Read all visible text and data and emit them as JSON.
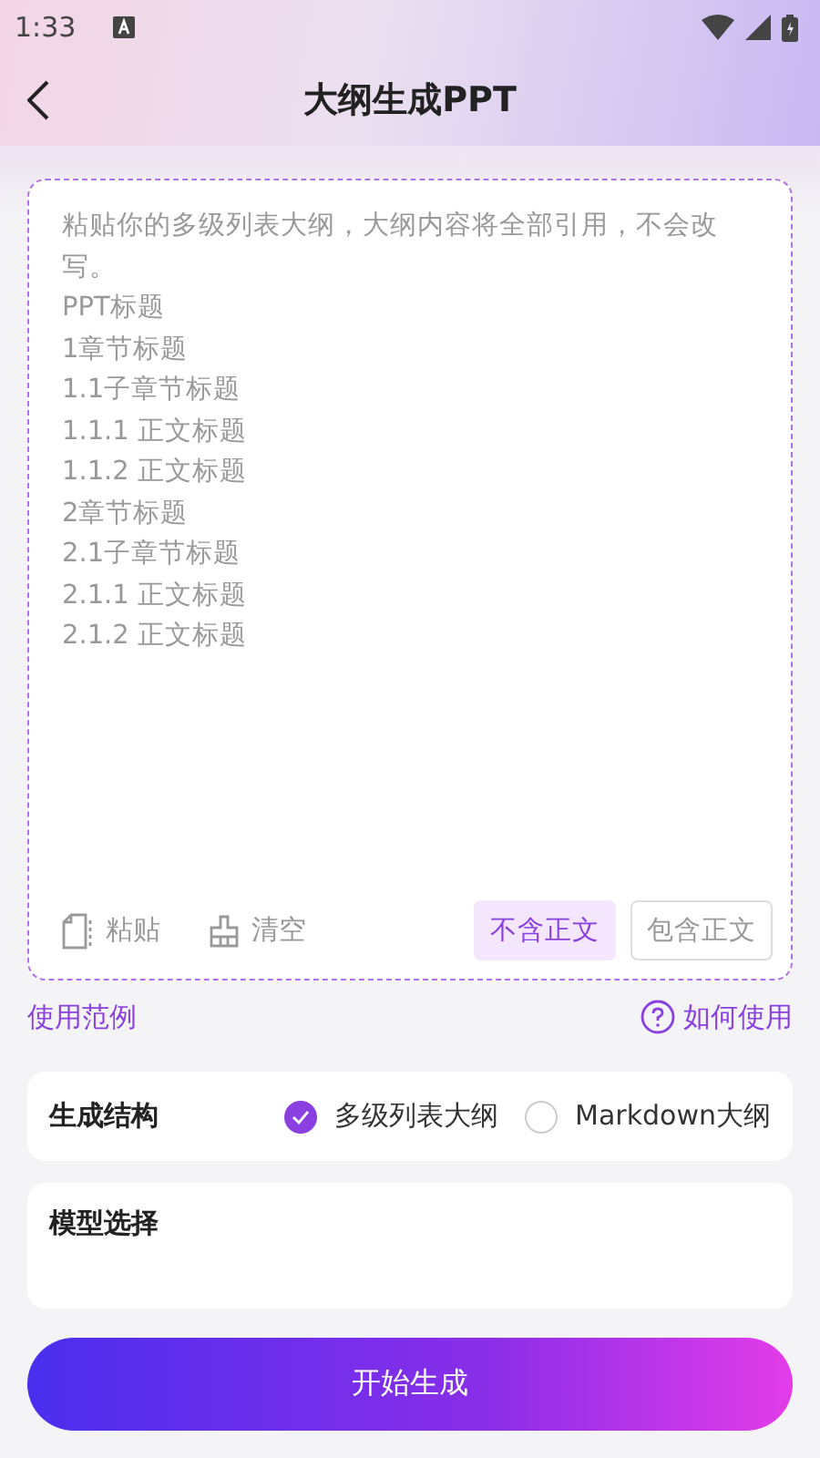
{
  "status_bar": {
    "time": "1:33"
  },
  "header": {
    "title": "大纲生成PPT"
  },
  "outline_input": {
    "placeholder": "粘贴你的多级列表大纲，大纲内容将全部引用，不会改写。\nPPT标题\n1章节标题\n1.1子章节标题\n1.1.1 正文标题\n1.1.2 正文标题\n2章节标题\n2.1子章节标题\n2.1.1 正文标题\n2.1.2 正文标题"
  },
  "tools": [
    {
      "label": "粘贴",
      "kind": "paste"
    },
    {
      "label": "清空",
      "kind": "clear"
    }
  ],
  "body_options": [
    {
      "label": "不含正文",
      "selected": true
    },
    {
      "label": "包含正文",
      "selected": false
    }
  ],
  "links": {
    "example": "使用范例",
    "help": "如何使用"
  },
  "structure": {
    "label": "生成结构",
    "options": [
      {
        "label": "多级列表大纲",
        "selected": true
      },
      {
        "label": "Markdown大纲",
        "selected": false
      }
    ]
  },
  "model": {
    "label": "模型选择"
  },
  "start_button": "开始生成"
}
